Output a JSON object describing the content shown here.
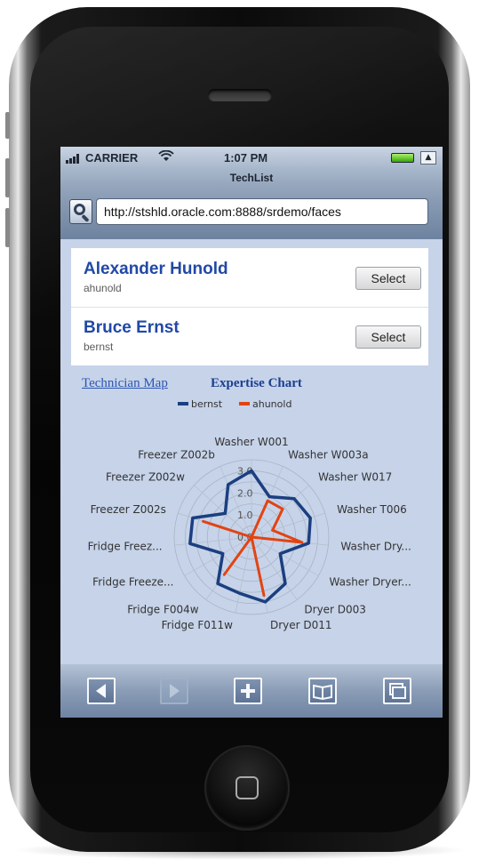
{
  "statusbar": {
    "carrier": "CARRIER",
    "time": "1:07 PM",
    "wifi_icon": "wifi-icon",
    "battery_icon": "battery-icon"
  },
  "browser": {
    "title": "TechList",
    "url": "http://stshld.oracle.com:8888/srdemo/faces",
    "search_icon": "search-icon",
    "reload_icon": "reload-icon"
  },
  "technicians": [
    {
      "name": "Alexander Hunold",
      "username": "ahunold",
      "button": "Select"
    },
    {
      "name": "Bruce Ernst",
      "username": "bernst",
      "button": "Select"
    }
  ],
  "tabs": {
    "map": "Technician Map",
    "chart": "Expertise Chart"
  },
  "toolbar": {
    "buttons": [
      "back-icon",
      "forward-icon",
      "add-icon",
      "bookmarks-icon",
      "pages-icon"
    ]
  },
  "colors": {
    "bernst": "#1b3f80",
    "ahunold": "#e14412"
  },
  "chart_data": {
    "type": "radar",
    "legend": [
      "bernst",
      "ahunold"
    ],
    "radial_ticks": [
      "0.0",
      "1.0",
      "2.0",
      "3.0"
    ],
    "rmax": 3.5,
    "categories": [
      "Washer W001",
      "Washer W003a",
      "Washer W017",
      "Washer T006",
      "Washer Dry...",
      "Washer Dryer...",
      "Dryer D003",
      "Dryer D011",
      "Fridge F011w",
      "Fridge F004w",
      "Fridge Freeze...",
      "Fridge Freez...",
      "Freezer Z002s",
      "Freezer Z002w",
      "Freezer Z002b"
    ],
    "series": [
      {
        "name": "bernst",
        "values": [
          3.0,
          2.0,
          2.6,
          2.8,
          2.6,
          1.5,
          2.6,
          3.0,
          2.6,
          2.6,
          1.5,
          2.8,
          2.8,
          1.6,
          2.6
        ]
      },
      {
        "name": "ahunold",
        "values": [
          0,
          1.8,
          1.9,
          1.0,
          2.3,
          0,
          0,
          2.7,
          0,
          2.1,
          0,
          0,
          2.3,
          0,
          0
        ]
      }
    ]
  }
}
